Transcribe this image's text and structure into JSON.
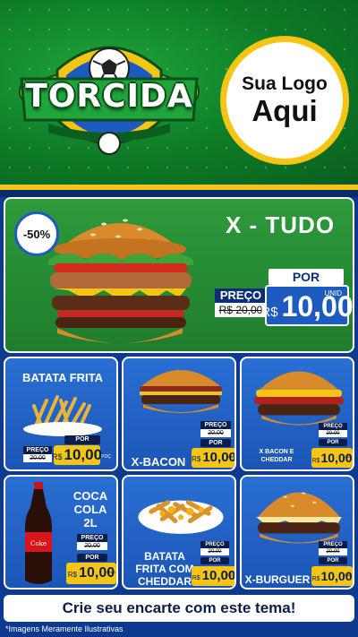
{
  "header": {
    "brand_text": "TORCIDA",
    "logo_line1": "Sua Logo",
    "logo_line2": "Aqui"
  },
  "feature": {
    "discount": "-50%",
    "title": "X - TUDO",
    "por": "POR",
    "preco": "PREÇO",
    "old_price": "R$ 20,00",
    "currency": "R$",
    "price": "10,00",
    "unid": "UNID"
  },
  "products": [
    {
      "name": "BATATA FRITA",
      "por": "POR",
      "preco": "PREÇO",
      "old_price": "20,00",
      "currency": "R$",
      "price": "10,00",
      "unid": "POÇ"
    },
    {
      "name": "X-BACON",
      "por": "POR",
      "preco": "PREÇO",
      "old_price": "20,00",
      "currency": "R$",
      "price": "10,00",
      "unid": "UNID"
    },
    {
      "name_line1": "X BACON E",
      "name_line2": "CHEDDAR",
      "por": "POR",
      "preco": "PREÇO",
      "old_price": "20,00",
      "currency": "R$",
      "price": "10,00",
      "unid": "UNID"
    },
    {
      "name_line1": "COCA",
      "name_line2": "COLA",
      "name_line3": "2L",
      "por": "POR",
      "preco": "PREÇO",
      "old_price": "20,00",
      "currency": "R$",
      "price": "10,00",
      "unid": "UNID"
    },
    {
      "name_line1": "BATATA",
      "name_line2": "FRITA COM",
      "name_line3": "CHEDDAR",
      "por": "POR",
      "preco": "PREÇO",
      "old_price": "20,00",
      "currency": "R$",
      "price": "10,00",
      "unid": "POÇ"
    },
    {
      "name": "X-BURGUER",
      "por": "POR",
      "preco": "PREÇO",
      "old_price": "20,00",
      "currency": "R$",
      "price": "10,00",
      "unid": "UNID"
    }
  ],
  "footer": {
    "cta": "Crie seu encarte com este tema!",
    "disclaimer": "*Imagens Meramente Ilustrativas"
  },
  "colors": {
    "green": "#1f8f32",
    "blue": "#1e5bc0",
    "yellow": "#f4c514",
    "navy": "#0b1d4a"
  }
}
